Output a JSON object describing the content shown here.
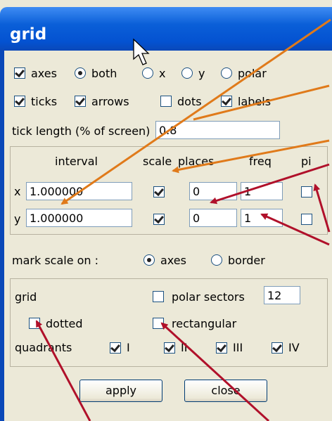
{
  "window": {
    "title": "grid"
  },
  "row1": {
    "axes": "axes",
    "both": "both",
    "x": "x",
    "y": "y",
    "polar": "polar"
  },
  "row2": {
    "ticks": "ticks",
    "arrows": "arrows",
    "dots": "dots",
    "labels": "labels"
  },
  "tick_length": {
    "label": "tick length (% of screen)",
    "value": "0.8"
  },
  "table": {
    "headers": {
      "interval": "interval",
      "scale": "scale",
      "places": "places",
      "freq": "freq",
      "pi": "pi"
    },
    "rows": [
      {
        "axis": "x",
        "interval": "1.000000",
        "scale": true,
        "places": "0",
        "freq": "1",
        "pi": false
      },
      {
        "axis": "y",
        "interval": "1.000000",
        "scale": true,
        "places": "0",
        "freq": "1",
        "pi": false
      }
    ]
  },
  "mark_scale": {
    "label": "mark scale on :",
    "axes": "axes",
    "border": "border"
  },
  "grid": {
    "label": "grid",
    "polar_sectors_label": "polar sectors",
    "polar_sectors_value": "12",
    "dotted": "dotted",
    "rectangular": "rectangular",
    "quadrants_label": "quadrants",
    "q1": "I",
    "q2": "II",
    "q3": "III",
    "q4": "IV"
  },
  "buttons": {
    "apply": "apply",
    "close": "close"
  },
  "colors": {
    "titlebar": "#0a5fd8",
    "orange_arrows": "#e07a1a",
    "red_arrows": "#b0102a"
  }
}
